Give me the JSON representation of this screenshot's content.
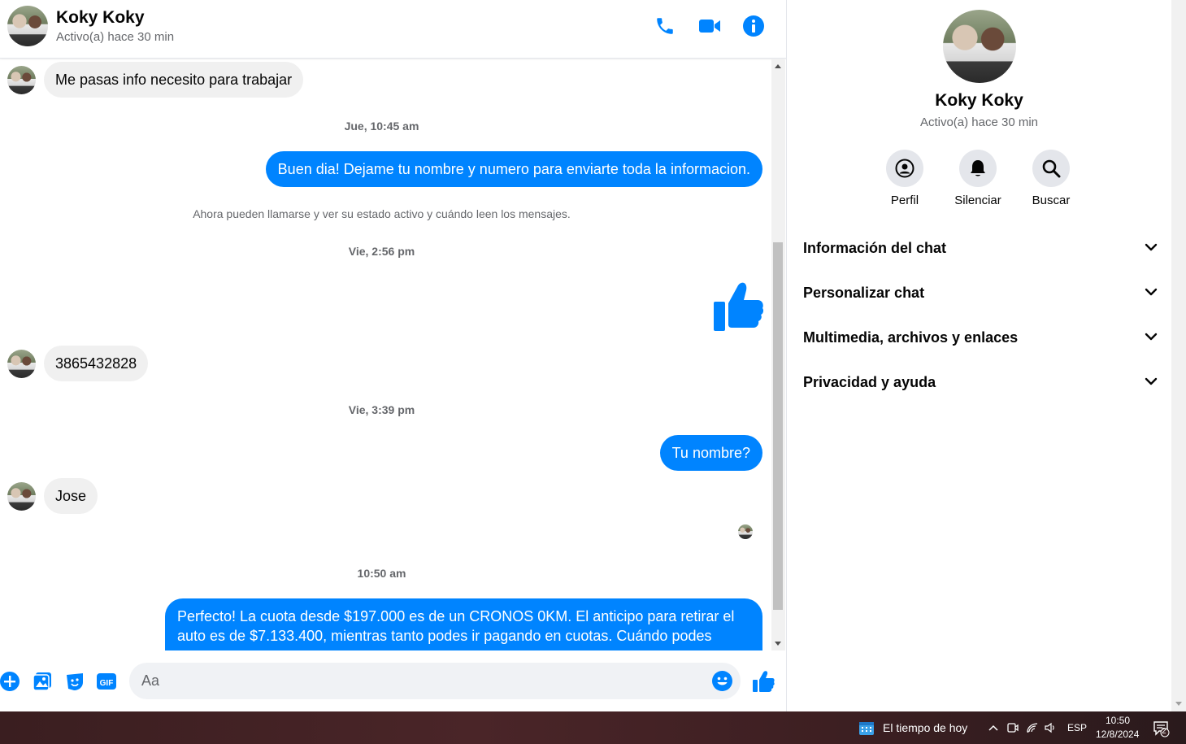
{
  "header": {
    "name": "Koky Koky",
    "status": "Activo(a) hace 30 min"
  },
  "messages": {
    "m1": "Me pasas info necesito para trabajar",
    "ts1": "Jue, 10:45 am",
    "m2": "Buen dia! Dejame tu nombre y numero para enviarte toda la informacion.",
    "sys1": "Ahora pueden llamarse y ver su estado activo y cuándo leen los mensajes.",
    "ts2": "Vie, 2:56 pm",
    "m3": "3865432828",
    "ts3": "Vie, 3:39 pm",
    "m4": "Tu nombre?",
    "m5": "Jose",
    "ts4": "10:50 am",
    "m6_line1": "Perfecto! La cuota desde $197.000 es de un CRONOS 0KM. El anticipo para retirar el",
    "m6_line2": "auto es de $7.133.400, mientras tanto podes ir pagando en cuotas. Cuándo podes"
  },
  "composer": {
    "placeholder": "Aa"
  },
  "info_panel": {
    "name": "Koky Koky",
    "status": "Activo(a) hace 30 min",
    "actions": {
      "profile": "Perfil",
      "mute": "Silenciar",
      "search": "Buscar"
    },
    "sections": {
      "chat_info": "Información del chat",
      "customize": "Personalizar chat",
      "media": "Multimedia, archivos y enlaces",
      "privacy": "Privacidad y ayuda"
    }
  },
  "taskbar": {
    "weather": "El tiempo de hoy",
    "lang": "ESP",
    "time": "10:50",
    "date": "12/8/2024",
    "notif_count": "2"
  },
  "colors": {
    "accent": "#0084ff",
    "bubble_in": "#f0f0f0",
    "secondary_text": "#65676b"
  }
}
